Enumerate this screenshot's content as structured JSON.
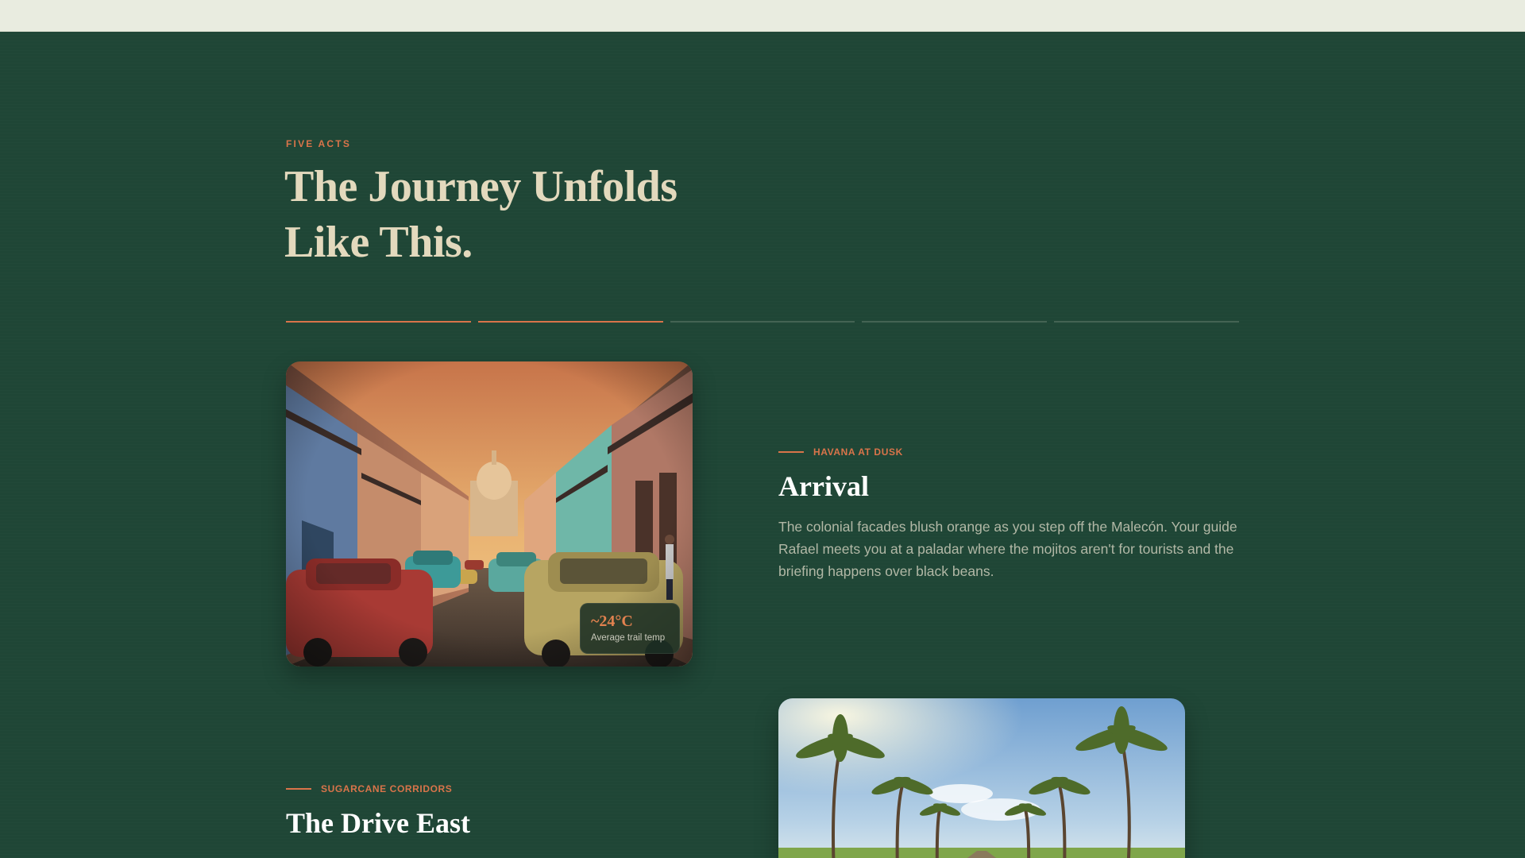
{
  "section": {
    "eyebrow": "FIVE ACTS",
    "title": "The Journey Unfolds Like This.",
    "progress": {
      "total_acts": 5,
      "active_acts": 2
    }
  },
  "acts": [
    {
      "kicker": "HAVANA AT DUSK",
      "title": "Arrival",
      "description": "The colonial facades blush orange as you step off the Malecón. Your guide Rafael meets you at a paladar where the mojitos aren't for tourists and the briefing happens over black beans.",
      "badge": {
        "value": "~24°C",
        "label": "Average trail temp"
      }
    },
    {
      "kicker": "SUGARCANE CORRIDORS",
      "title": "The Drive East"
    }
  ],
  "colors": {
    "background": "#1f4636",
    "accent": "#d9744a",
    "headline": "#e3d9bd",
    "topbar": "#e9ece0"
  }
}
